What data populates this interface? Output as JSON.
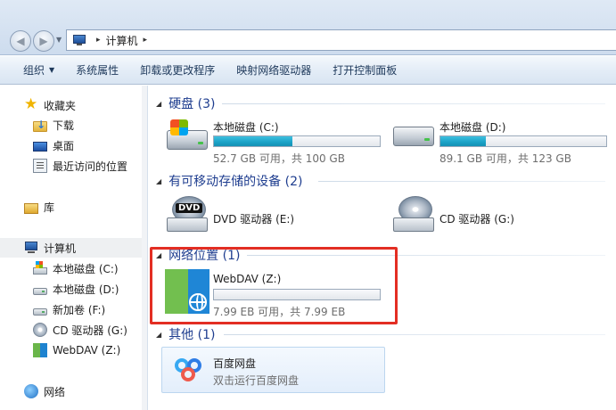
{
  "address": {
    "separator": "▸",
    "path": "计算机",
    "trailing_separator": "▸"
  },
  "nav": {
    "back_icon": "back-arrow-icon",
    "forward_icon": "forward-arrow-icon",
    "dropdown_icon": "chevron-down-icon"
  },
  "commands": {
    "organize": "组织",
    "system_properties": "系统属性",
    "uninstall": "卸载或更改程序",
    "map_drive": "映射网络驱动器",
    "control_panel": "打开控制面板"
  },
  "sidebar": {
    "favorites": "收藏夹",
    "downloads": "下载",
    "desktop": "桌面",
    "recent": "最近访问的位置",
    "libraries": "库",
    "computer": "计算机",
    "drive_c": "本地磁盘 (C:)",
    "drive_d": "本地磁盘 (D:)",
    "drive_f": "新加卷 (F:)",
    "drive_g": "CD 驱动器 (G:)",
    "drive_z": "WebDAV (Z:)",
    "network": "网络"
  },
  "groups": {
    "hard_disks": "硬盘 (3)",
    "removable": "有可移动存储的设备 (2)",
    "network_locations": "网络位置 (1)",
    "other": "其他 (1)"
  },
  "drives": {
    "c": {
      "name": "本地磁盘 (C:)",
      "info": "52.7 GB 可用，共 100 GB",
      "used_fraction": 0.473
    },
    "d": {
      "name": "本地磁盘 (D:)",
      "info": "89.1 GB 可用，共 123 GB",
      "used_fraction": 0.276
    },
    "e": {
      "name": "DVD 驱动器 (E:)",
      "label": "DVD"
    },
    "g": {
      "name": "CD 驱动器 (G:)"
    },
    "z": {
      "name": "WebDAV (Z:)",
      "info": "7.99 EB 可用，共 7.99 EB",
      "used_fraction": 0.0
    }
  },
  "other": {
    "app_name": "百度网盘",
    "app_desc": "双击运行百度网盘"
  },
  "colors": {
    "accent_header": "#1e3d8f",
    "highlight_border": "#e32e23",
    "bar_fill": "#1aa1c6"
  }
}
